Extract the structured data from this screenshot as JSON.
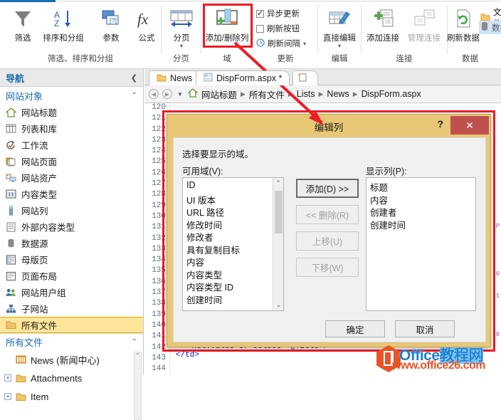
{
  "ribbon": {
    "groups": [
      {
        "label": "筛选、排序和分组",
        "buttons": [
          {
            "name": "filter",
            "label": "筛选",
            "icon": "funnel-icon"
          },
          {
            "name": "sort-group",
            "label": "排序和分组",
            "icon": "sort-az-icon"
          },
          {
            "name": "parameters",
            "label": "参数",
            "icon": "parameters-icon"
          },
          {
            "name": "formula",
            "label": "公式",
            "icon": "formula-fx-icon"
          }
        ]
      },
      {
        "label": "分页",
        "buttons": [
          {
            "name": "paging",
            "label": "分页",
            "icon": "paging-icon",
            "caret": "▾"
          }
        ]
      },
      {
        "label": "域",
        "buttons": [
          {
            "name": "add-remove-columns",
            "label": "添加/删除列",
            "icon": "add-remove-columns-icon"
          }
        ]
      },
      {
        "label": "更新",
        "checks": [
          {
            "name": "async-update",
            "label": "异步更新",
            "checked": true
          },
          {
            "name": "refresh-button",
            "label": "刷新按钮",
            "checked": false
          },
          {
            "name": "refresh-interval",
            "label": "刷新间隔",
            "checked": false,
            "icon": "clock-icon",
            "caret": "▾"
          }
        ]
      },
      {
        "label": "编辑",
        "buttons": [
          {
            "name": "direct-edit",
            "label": "直接编辑",
            "icon": "direct-edit-icon",
            "caret": "▾"
          }
        ]
      },
      {
        "label": "连接",
        "buttons": [
          {
            "name": "add-connection",
            "label": "添加连接",
            "icon": "add-connection-icon"
          },
          {
            "name": "manage-connection",
            "label": "管理连接",
            "icon": "manage-connection-icon",
            "disabled": true
          }
        ]
      },
      {
        "label": "数据",
        "buttons": [
          {
            "name": "refresh-data",
            "label": "刷新数据",
            "icon": "refresh-data-icon"
          }
        ],
        "small": [
          {
            "name": "file",
            "label": "文件",
            "icon": "folder-icon"
          },
          {
            "name": "data",
            "label": "数据",
            "icon": "database-icon",
            "selected": true
          }
        ]
      }
    ]
  },
  "nav": {
    "title": "导航",
    "collapse_icon": "chevron-left-icon",
    "section_site_objects": {
      "label": "网站对象",
      "chevron": "chevron-up-icon",
      "items": [
        {
          "label": "网站标题",
          "icon": "home-icon"
        },
        {
          "label": "列表和库",
          "icon": "table-icon"
        },
        {
          "label": "工作流",
          "icon": "workflow-icon"
        },
        {
          "label": "网站页面",
          "icon": "pages-icon"
        },
        {
          "label": "网站资产",
          "icon": "assets-icon"
        },
        {
          "label": "内容类型",
          "icon": "content-type-icon"
        },
        {
          "label": "网站列",
          "icon": "site-column-icon"
        },
        {
          "label": "外部内容类型",
          "icon": "external-content-icon"
        },
        {
          "label": "数据源",
          "icon": "datasource-icon"
        },
        {
          "label": "母版页",
          "icon": "master-page-icon"
        },
        {
          "label": "页面布局",
          "icon": "page-layout-icon"
        },
        {
          "label": "网站用户组",
          "icon": "users-icon"
        },
        {
          "label": "子网站",
          "icon": "subsite-icon"
        },
        {
          "label": "所有文件",
          "icon": "folder-icon",
          "selected": true
        }
      ]
    },
    "section_all_files": {
      "label": "所有文件",
      "chevron": "chevron-up-icon",
      "items": [
        {
          "label": "News (新闻中心)",
          "icon": "list-icon",
          "expander": ""
        },
        {
          "label": "Attachments",
          "icon": "folder-icon",
          "expander": "+"
        },
        {
          "label": "Item",
          "icon": "folder-icon",
          "expander": "+"
        }
      ]
    }
  },
  "editor": {
    "tabs": [
      {
        "label": "News",
        "icon": "folder-icon",
        "active": false
      },
      {
        "label": "DispForm.aspx *",
        "icon": "page-icon",
        "active": true
      },
      {
        "label": "",
        "icon": "new-page-icon",
        "active": false
      }
    ],
    "breadcrumb": {
      "back_icon": "back-arrow-icon",
      "forward_icon": "forward-arrow-icon",
      "dropdown_icon": "chevron-down-icon",
      "home_icon": "home-icon",
      "items": [
        "网站标题",
        "所有文件",
        "Lists",
        "News",
        "DispForm.aspx"
      ]
    },
    "line_numbers": [
      120,
      121,
      122,
      123,
      124,
      125,
      126,
      127,
      128,
      129,
      130,
      131,
      132,
      133,
      134,
      135,
      136,
      137,
      138,
      139,
      140,
      141,
      142,
      143,
      144
    ],
    "code_snippet": "<xsl:value-of select=\"@Title\"/>",
    "code_snippet2": "</td>",
    "ruler_marks": [
      "P",
      "0",
      "1",
      "0"
    ]
  },
  "dialog": {
    "title": "编辑列",
    "help_label": "?",
    "close_label": "✕",
    "description": "选择要显示的域。",
    "available_label": "可用域(V):",
    "available_items": [
      "ID",
      "UI 版本",
      "URL 路径",
      "修改时间",
      "修改者",
      "具有复制目标",
      "内容",
      "内容类型",
      "内容类型 ID",
      "创建时间"
    ],
    "displayed_label": "显示列(P):",
    "displayed_items": [
      "标题",
      "内容",
      "创建者",
      "创建时间"
    ],
    "mid_buttons": [
      {
        "name": "add-button",
        "label": "添加(D) >>",
        "disabled": false,
        "focus": true
      },
      {
        "name": "remove-button",
        "label": "<< 删除(R)",
        "disabled": true,
        "focus": false
      },
      {
        "name": "move-up-button",
        "label": "上移(U)",
        "disabled": true,
        "focus": false
      },
      {
        "name": "move-down-button",
        "label": "下移(W)",
        "disabled": true,
        "focus": false
      }
    ],
    "ok_label": "确定",
    "cancel_label": "取消"
  },
  "watermark": {
    "top_en": "Office",
    "top_cn": "教程网",
    "bottom": "www.office26.com"
  },
  "colors": {
    "accent_blue": "#1b6cb0",
    "highlight_red": "#ee1c25",
    "dialog_gold": "#e8c877",
    "selected_yellow": "#ffe599",
    "close_red": "#c0504d"
  }
}
